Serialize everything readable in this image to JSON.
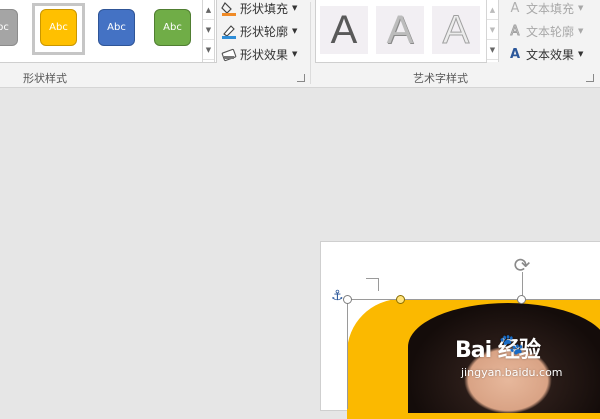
{
  "ribbon": {
    "shape_styles": {
      "group_label": "形状样式",
      "swatches": [
        {
          "label": "Abc",
          "color": "#a5a5a5",
          "selected": false
        },
        {
          "label": "Abc",
          "color": "#ffc000",
          "selected": true
        },
        {
          "label": "Abc",
          "color": "#4472c4",
          "selected": false
        },
        {
          "label": "Abc",
          "color": "#70ad47",
          "selected": false
        }
      ],
      "commands": {
        "fill": "形状填充",
        "outline": "形状轮廓",
        "effects": "形状效果"
      }
    },
    "wordart_styles": {
      "group_label": "艺术字样式",
      "items": [
        {
          "glyph": "A",
          "style": "solid-gray"
        },
        {
          "glyph": "A",
          "style": "gradient-gray"
        },
        {
          "glyph": "A",
          "style": "outline-gray"
        }
      ],
      "commands": {
        "text_fill": "文本填充",
        "text_outline": "文本轮廓",
        "text_effects": "文本效果"
      }
    }
  },
  "watermark": {
    "brand": "Bai 经验",
    "url": "jingyan.baidu.com"
  },
  "colors": {
    "accent_fill": "#ffc000",
    "shape_yellow": "#fbb900",
    "anchor_blue": "#2b579a"
  }
}
